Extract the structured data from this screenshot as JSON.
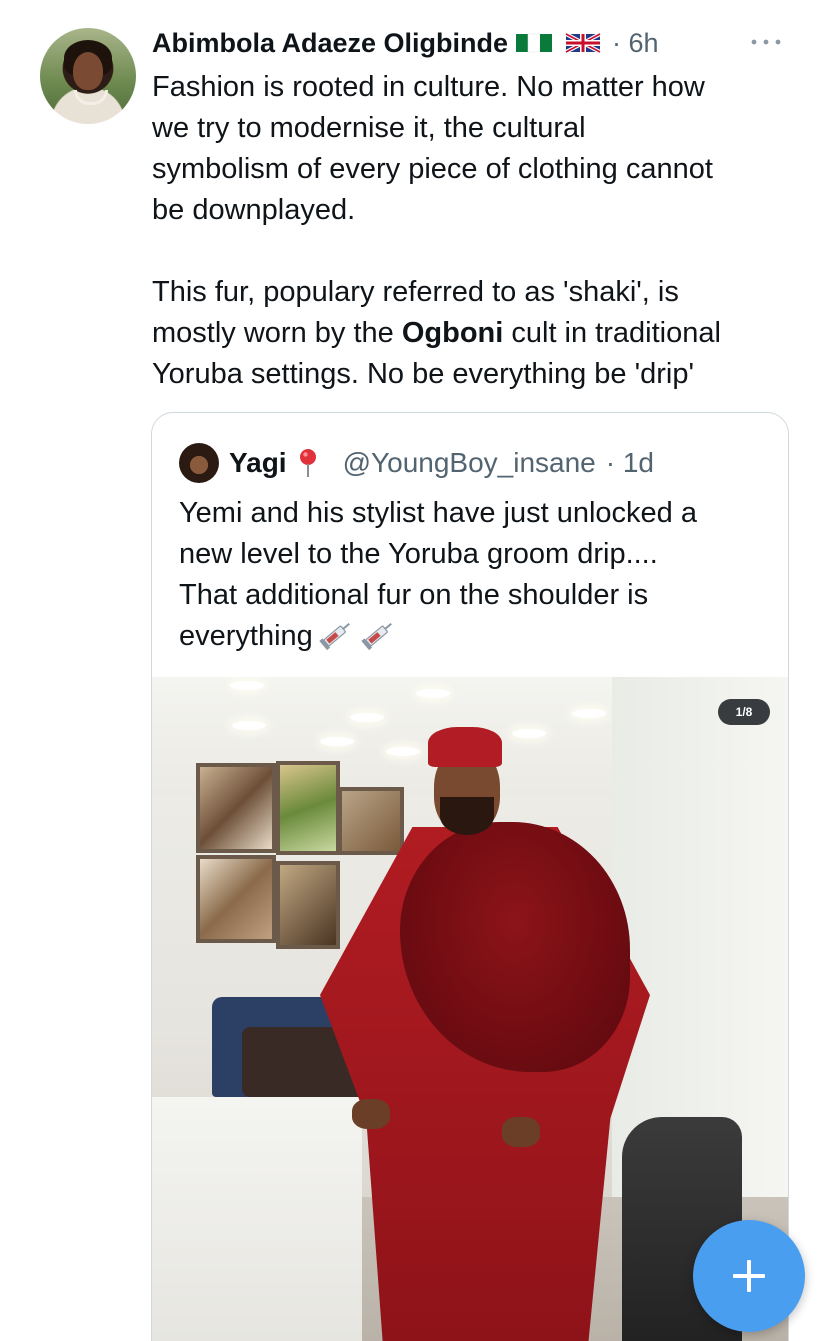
{
  "post": {
    "author_name": "Abimbola Adaeze Oligbinde",
    "flags": [
      "nigeria-flag",
      "uk-flag"
    ],
    "time": "· 6h",
    "more_icon": "more-horizontal-icon",
    "text_lines_para1": [
      "Fashion is rooted in culture. No matter how",
      "we try to modernise it, the cultural",
      "symbolism of every piece of clothing cannot",
      "be downplayed."
    ],
    "para2_line1": "This fur, populary referred to as  'shaki', is",
    "para2_line2_before": "mostly worn by the ",
    "para2_line2_bold": "Ogboni",
    "para2_line2_after": " cult in traditional",
    "para2_line3": "Yoruba settings. No be everything be 'drip'"
  },
  "quote": {
    "name": "Yagi",
    "handle": "@YoungBoy_insane",
    "time": "· 1d",
    "lines": [
      "Yemi and his stylist have just unlocked a",
      "new level to the Yoruba groom drip....",
      "That additional fur on the shoulder is",
      "everything"
    ],
    "emojis": [
      "syringe-icon",
      "syringe-icon"
    ],
    "media": {
      "slide_badge": "1/8"
    }
  },
  "fab": {
    "icon": "plus-icon",
    "color": "#4a9ef0"
  },
  "colors": {
    "text_primary": "#0f1419",
    "text_secondary": "#536471",
    "border": "#cfd9de"
  }
}
